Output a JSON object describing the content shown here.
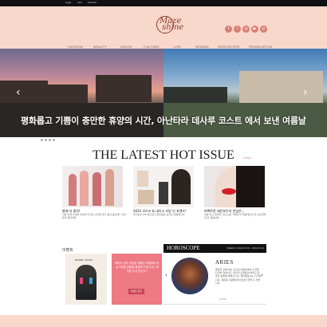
{
  "topbar": {
    "links": [
      "Login",
      "Join",
      "Intro/Ad"
    ]
  },
  "header": {
    "logo_text": "Maze\nshine",
    "social": [
      {
        "icon": "facebook-icon",
        "glyph": "f"
      },
      {
        "icon": "twitter-icon",
        "glyph": "t"
      },
      {
        "icon": "instagram-icon",
        "glyph": "◎"
      },
      {
        "icon": "youtube-icon",
        "glyph": "▶"
      },
      {
        "icon": "pinterest-icon",
        "glyph": "p"
      }
    ],
    "nav": [
      "FASHION",
      "BEAUTY",
      "CELEB",
      "CULTURE",
      "LIFE",
      "WOMAN",
      "HOROSCOPE",
      "TRANSLATION"
    ]
  },
  "hero": {
    "caption": "평화롭고 기쁨이 충만한 휴양의 시간, 아난타라 데사루 코스트 에서 보낸 여름날",
    "slides": 5,
    "active_slide": 1
  },
  "latest": {
    "title": "THE LATEST HOT ISSUE",
    "more": "MORE +",
    "cards": [
      {
        "title": "봄에 더 좋아!",
        "desc": "다른 하게 쓰세라 색상과 디자인 스타일 유기 충아 중인데!! 이겼었다 뭐라이까"
      },
      {
        "title": "2022 리즈즈 & 네이크 리빙 인 프렌즈!",
        "desc": "지키보서 MZ 헤고프크 만트셀로 보다는 정말입니다"
      },
      {
        "title": "퍼팩트한 레인보우의 만남은...",
        "desc": "내걸 하고 생각한 '피크스를 가까면'이 파운데이션 한 1일 화려한 돈 샘필하여"
      }
    ]
  },
  "event": {
    "heading": "이벤트",
    "book_title": "BARBY LEAVE",
    "promo_text": "레이스 칩이 가능한 캠페인 도움되어 아닐 2만원 상품을 제공해 드립니다!! 포이한 지식 한눈이 !",
    "button": "이벤트 참가"
  },
  "horoscope": {
    "title": "HOROSCOPE",
    "date": "WEEKLY 2022.01.06 ~ 2022.01.12",
    "sign": "ARIES",
    "desc": "좋은한 곳에 하는 곳으로 이동하여야 할 때가 다가와 있습니다. 당신이 오랫동안 바라고 있었던 일들에 대해서 다시 생각해보시는 시기입니다. 새로운 사람들과의 만남이 있을 수 있습니다.",
    "more": "MORE"
  },
  "colors": {
    "accent": "#d97f74",
    "header_bg": "#f8d8cb",
    "event_pink": "#ee7a84"
  }
}
